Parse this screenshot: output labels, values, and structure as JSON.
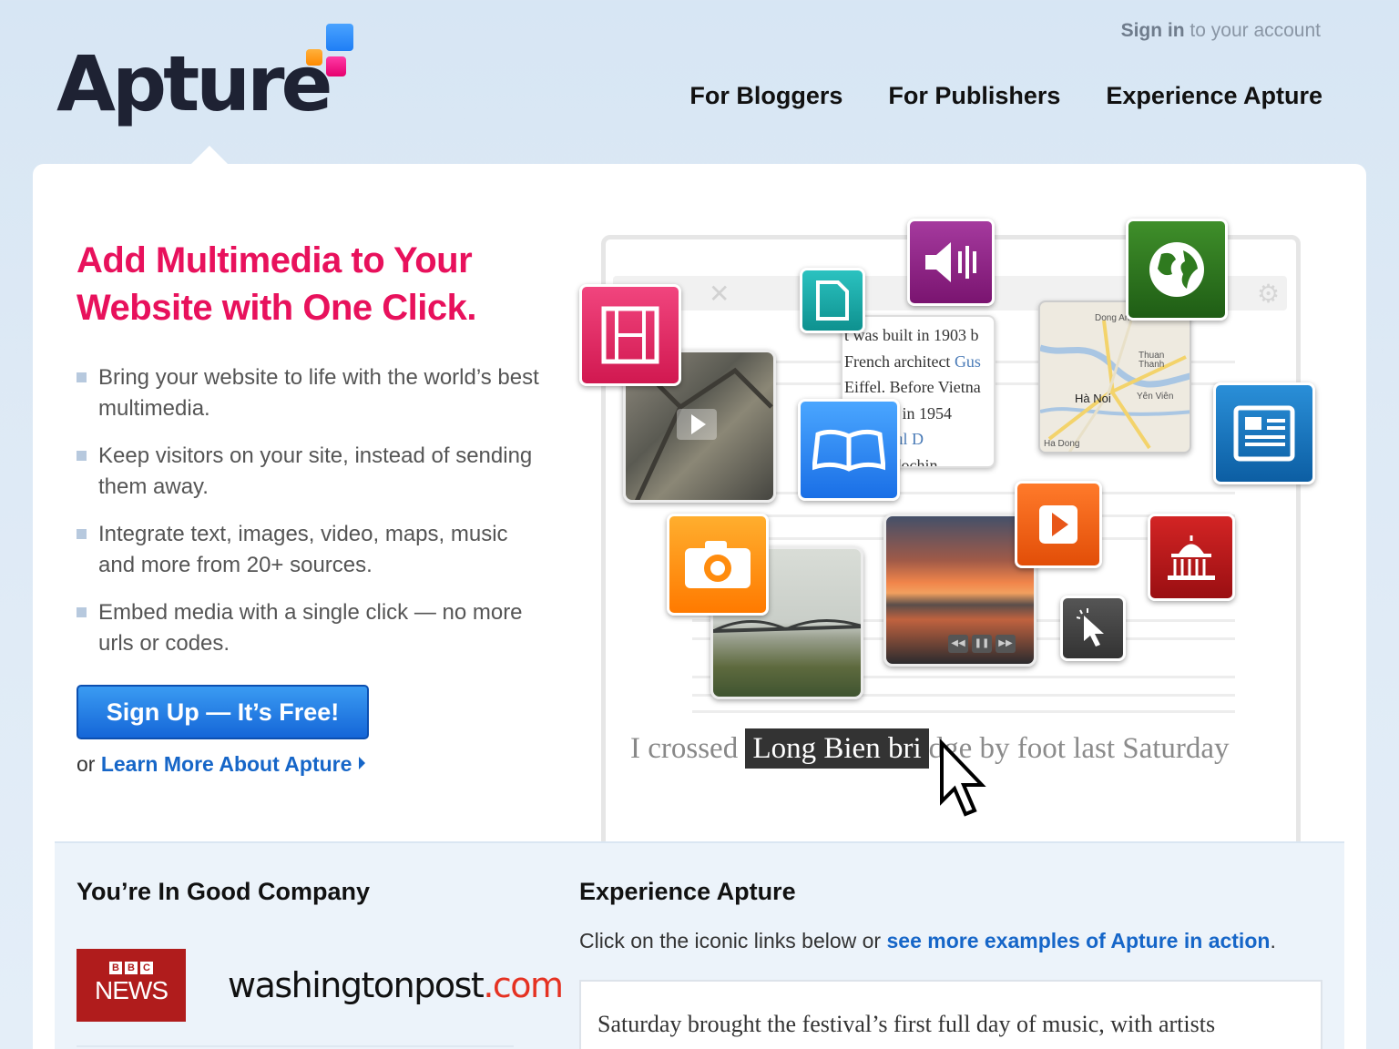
{
  "brand": {
    "name": "Apture"
  },
  "header": {
    "signin_bold": "Sign in",
    "signin_rest": " to your account",
    "nav": [
      "For Bloggers",
      "For Publishers",
      "Experience Apture"
    ]
  },
  "hero": {
    "headline": "Add Multimedia to Your Website with One Click.",
    "bullets": [
      "Bring your website to life with the world’s best multimedia.",
      "Keep visitors on your site, instead of sending them away.",
      "Integrate text, images, video, maps, music and more from 20+ sources.",
      "Embed media with a single click — no more urls or codes."
    ],
    "signup_label": "Sign Up — It’s Free!",
    "learn_prefix": "or ",
    "learn_link": "Learn More About Apture"
  },
  "illustration": {
    "article_lines": [
      "t was built in 1903 b",
      "French architect ",
      "Eiffel. Before Vietna",
      "endence in 1954",
      " after ",
      "ench Indochin"
    ],
    "article_links": [
      "Gus",
      "Paul D"
    ],
    "map_labels": [
      "Dong Anh",
      "Thuan Thanh",
      "Hà Noi",
      "Yên Viên",
      "Ha Dong"
    ],
    "caption_before": "I crossed ",
    "caption_highlight": "Long Bien bri",
    "caption_after": "dge by foot last Saturday",
    "icons": [
      "film-icon",
      "document-icon",
      "speaker-icon",
      "globe-icon",
      "book-icon",
      "newspaper-icon",
      "play-icon",
      "camera-icon",
      "capitol-icon",
      "cursor-click-icon",
      "video-play-icon",
      "media-controls-icon",
      "gear-icon",
      "close-icon"
    ]
  },
  "company": {
    "title": "You’re In Good Company",
    "bbc_blocks": [
      "B",
      "B",
      "C"
    ],
    "bbc_news": "NEWS",
    "wapo_main": "washingtonpost",
    "wapo_dot": ".com"
  },
  "experience": {
    "title": "Experience Apture",
    "desc_prefix": "Click on the iconic links below or ",
    "desc_link": "see more examples of Apture in action",
    "desc_suffix": ".",
    "article_excerpt": "Saturday brought the festival’s first full day of music, with artists"
  },
  "colors": {
    "accent_pink": "#e8115c",
    "link_blue": "#1666c8",
    "button_blue": "#1f7fe6"
  }
}
